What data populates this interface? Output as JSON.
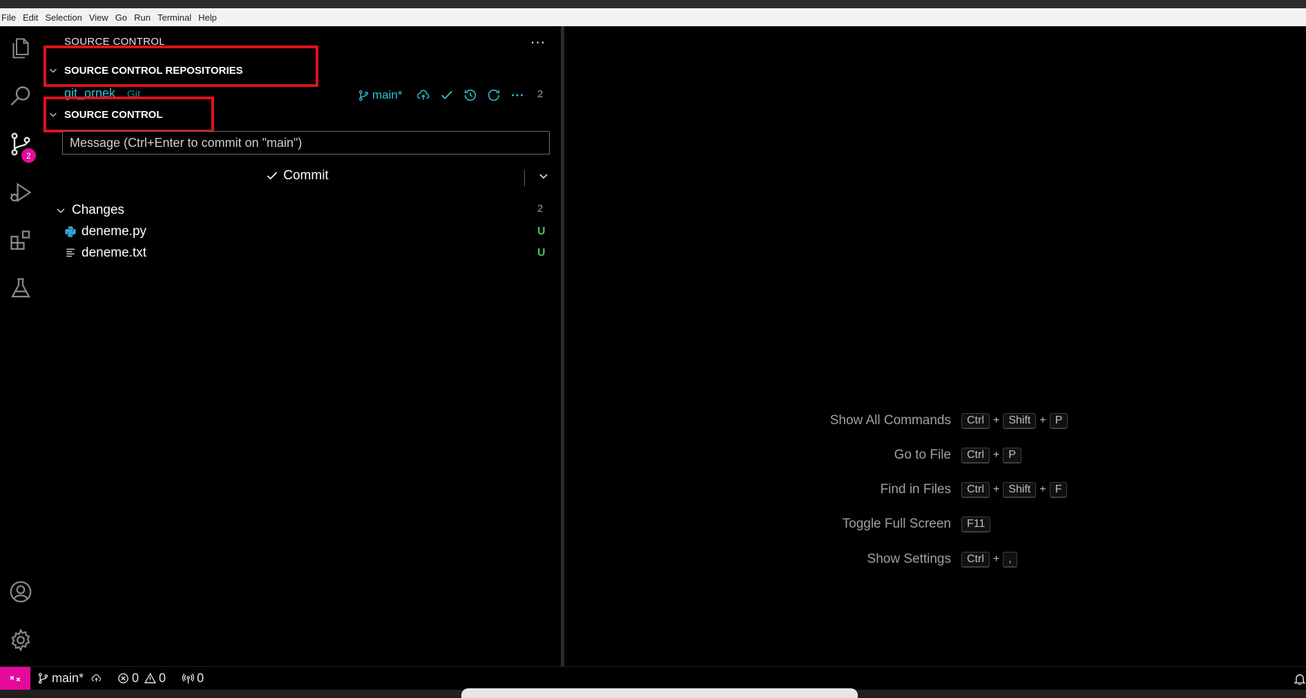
{
  "menu": [
    "File",
    "Edit",
    "Selection",
    "View",
    "Go",
    "Run",
    "Terminal",
    "Help"
  ],
  "activity_bar": {
    "items": [
      {
        "name": "explorer",
        "icon": "files-icon"
      },
      {
        "name": "search",
        "icon": "search-icon"
      },
      {
        "name": "source-control",
        "icon": "source-control-icon",
        "badge": "2"
      },
      {
        "name": "run-debug",
        "icon": "run-debug-icon"
      },
      {
        "name": "extensions",
        "icon": "extensions-icon"
      },
      {
        "name": "testing",
        "icon": "beaker-icon"
      }
    ],
    "bottom": [
      {
        "name": "accounts",
        "icon": "account-icon"
      },
      {
        "name": "manage",
        "icon": "gear-icon"
      }
    ]
  },
  "sidebar": {
    "title": "SOURCE CONTROL",
    "repositories_header": "SOURCE CONTROL REPOSITORIES",
    "repository": {
      "name": "git_ornek",
      "provider": "Git",
      "branch": "main*",
      "count": "2"
    },
    "source_control_header": "SOURCE CONTROL",
    "commit_message_placeholder": "Message (Ctrl+Enter to commit on \"main\")",
    "commit_button": "Commit",
    "changes": {
      "label": "Changes",
      "count": "2",
      "files": [
        {
          "name": "deneme.py",
          "status": "U",
          "icon": "python-icon"
        },
        {
          "name": "deneme.txt",
          "status": "U",
          "icon": "text-file-icon"
        }
      ]
    }
  },
  "editor_hints": [
    {
      "label": "Show All Commands",
      "keys": [
        "Ctrl",
        "Shift",
        "P"
      ]
    },
    {
      "label": "Go to File",
      "keys": [
        "Ctrl",
        "P"
      ]
    },
    {
      "label": "Find in Files",
      "keys": [
        "Ctrl",
        "Shift",
        "F"
      ]
    },
    {
      "label": "Toggle Full Screen",
      "keys": [
        "F11"
      ]
    },
    {
      "label": "Show Settings",
      "keys": [
        "Ctrl",
        ","
      ]
    }
  ],
  "status_bar": {
    "branch": "main*",
    "errors": "0",
    "warnings": "0",
    "ports": "0"
  },
  "colors": {
    "accent": "#e50a9c",
    "highlight_box": "#e0131b",
    "repo_text": "#2ec4d6",
    "untracked": "#38c95b"
  }
}
